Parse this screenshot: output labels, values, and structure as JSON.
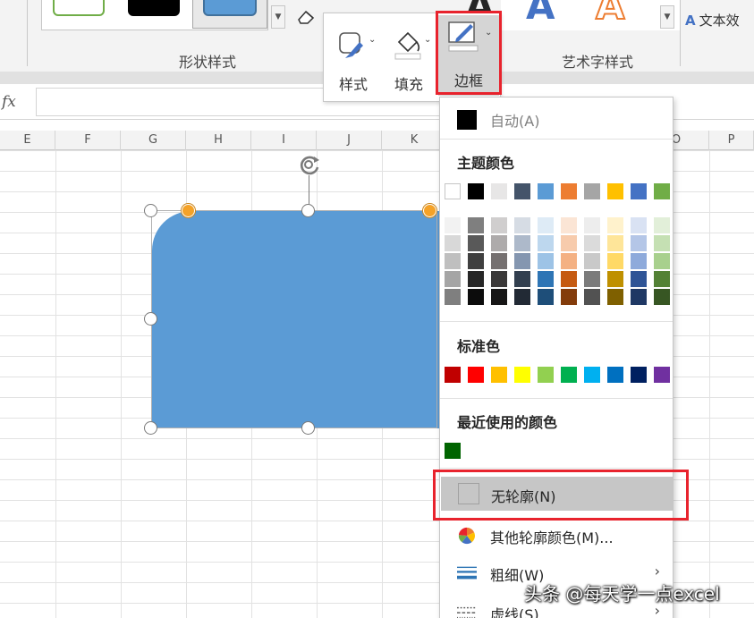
{
  "ribbon": {
    "shape_styles_label": "形状样式",
    "wordart_styles_label": "艺术字样式",
    "text_effects_label": "文本效",
    "wordart_letters": [
      "A",
      "A",
      "A"
    ],
    "wordart_colors": [
      "#000000",
      "#4472c4",
      "#ed7d31"
    ]
  },
  "mini_toolbar": {
    "style_label": "样式",
    "fill_label": "填充",
    "border_label": "边框"
  },
  "formula_bar": {
    "fx_label": "fx",
    "value": ""
  },
  "columns": [
    "E",
    "F",
    "G",
    "H",
    "I",
    "J",
    "K",
    "O",
    "P"
  ],
  "dropdown": {
    "auto_label": "自动(A)",
    "theme_colors_title": "主题颜色",
    "theme_top_row": [
      "#ffffff",
      "#000000",
      "#e7e6e6",
      "#44546a",
      "#5b9bd5",
      "#ed7d31",
      "#a5a5a5",
      "#ffc000",
      "#4472c4",
      "#70ad47"
    ],
    "theme_shades": [
      [
        "#f2f2f2",
        "#7f7f7f",
        "#d0cece",
        "#d6dce4",
        "#deebf6",
        "#fbe5d5",
        "#ededed",
        "#fff2cc",
        "#d9e2f3",
        "#e2efd9"
      ],
      [
        "#d8d8d8",
        "#595959",
        "#aeabab",
        "#adb9ca",
        "#bdd7ee",
        "#f7cbac",
        "#dbdbdb",
        "#fee599",
        "#b4c6e7",
        "#c5e0b3"
      ],
      [
        "#bfbfbf",
        "#3f3f3f",
        "#757070",
        "#8496b0",
        "#9dc3e6",
        "#f4b183",
        "#c9c9c9",
        "#ffd966",
        "#8eaadb",
        "#a8d08d"
      ],
      [
        "#a5a5a5",
        "#262626",
        "#3a3838",
        "#323f4f",
        "#2e75b5",
        "#c55a11",
        "#7b7b7b",
        "#bf9000",
        "#2f5496",
        "#538135"
      ],
      [
        "#7f7f7f",
        "#0c0c0c",
        "#171616",
        "#222a35",
        "#1e4e79",
        "#833c0b",
        "#525252",
        "#7f6000",
        "#1f3864",
        "#375623"
      ]
    ],
    "standard_colors_title": "标准色",
    "standard_colors": [
      "#c00000",
      "#ff0000",
      "#ffc000",
      "#ffff00",
      "#92d050",
      "#00b050",
      "#00b0f0",
      "#0070c0",
      "#002060",
      "#7030a0"
    ],
    "recent_colors_title": "最近使用的颜色",
    "recent_colors": [
      "#006400"
    ],
    "no_outline_label": "无轮廓(N)",
    "more_colors_label": "其他轮廓颜色(M)...",
    "weight_label": "粗细(W)",
    "dashes_label": "虚线(S)"
  },
  "watermark": "头条 @每天学一点excel"
}
